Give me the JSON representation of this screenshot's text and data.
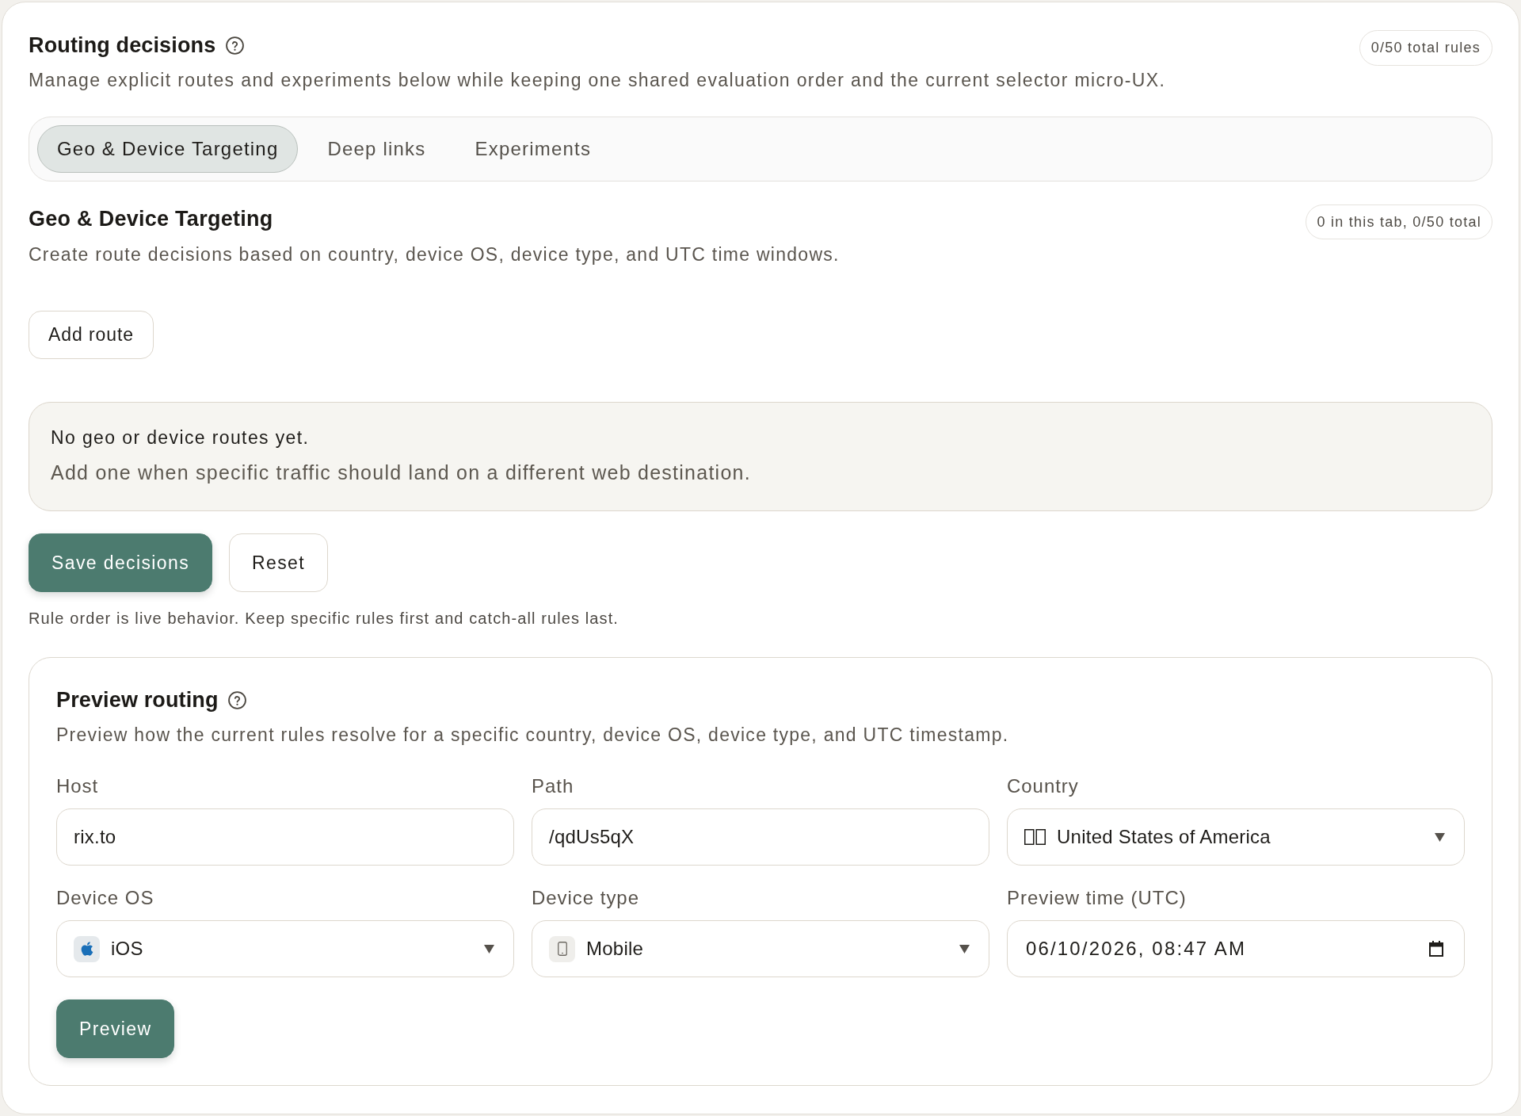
{
  "header": {
    "title": "Routing decisions",
    "badge": "0/50 total rules",
    "description": "Manage explicit routes and experiments below while keeping one shared evaluation order and the current selector micro-UX."
  },
  "tabs": [
    {
      "label": "Geo & Device Targeting",
      "selected": true
    },
    {
      "label": "Deep links",
      "selected": false
    },
    {
      "label": "Experiments",
      "selected": false
    }
  ],
  "section": {
    "title": "Geo & Device Targeting",
    "badge": "0 in this tab, 0/50 total",
    "description": "Create route decisions based on country, device OS, device type, and UTC time windows.",
    "add_button": "Add route",
    "empty_state": {
      "title": "No geo or device routes yet.",
      "message": "Add one when specific traffic should land on a different web destination."
    }
  },
  "actions": [
    {
      "label": "Save decisions",
      "kind": "primary"
    },
    {
      "label": "Reset",
      "kind": "secondary"
    }
  ],
  "note": "Rule order is live behavior. Keep specific rules first and catch-all rules last.",
  "preview": {
    "title": "Preview routing",
    "description": "Preview how the current rules resolve for a specific country, device OS, device type, and UTC timestamp.",
    "fields": [
      {
        "label": "Host",
        "kind": "text",
        "value": "rix.to"
      },
      {
        "label": "Path",
        "kind": "text",
        "value": "/qdUs5qX"
      },
      {
        "label": "Country",
        "kind": "select",
        "value": "United States of America"
      },
      {
        "label": "Device OS",
        "kind": "select",
        "value": "iOS"
      },
      {
        "label": "Device type",
        "kind": "select",
        "value": "Mobile"
      },
      {
        "label": "Preview time (UTC)",
        "kind": "datetime",
        "value": "06/10/2026, 08:47 AM"
      }
    ],
    "button": "Preview"
  }
}
